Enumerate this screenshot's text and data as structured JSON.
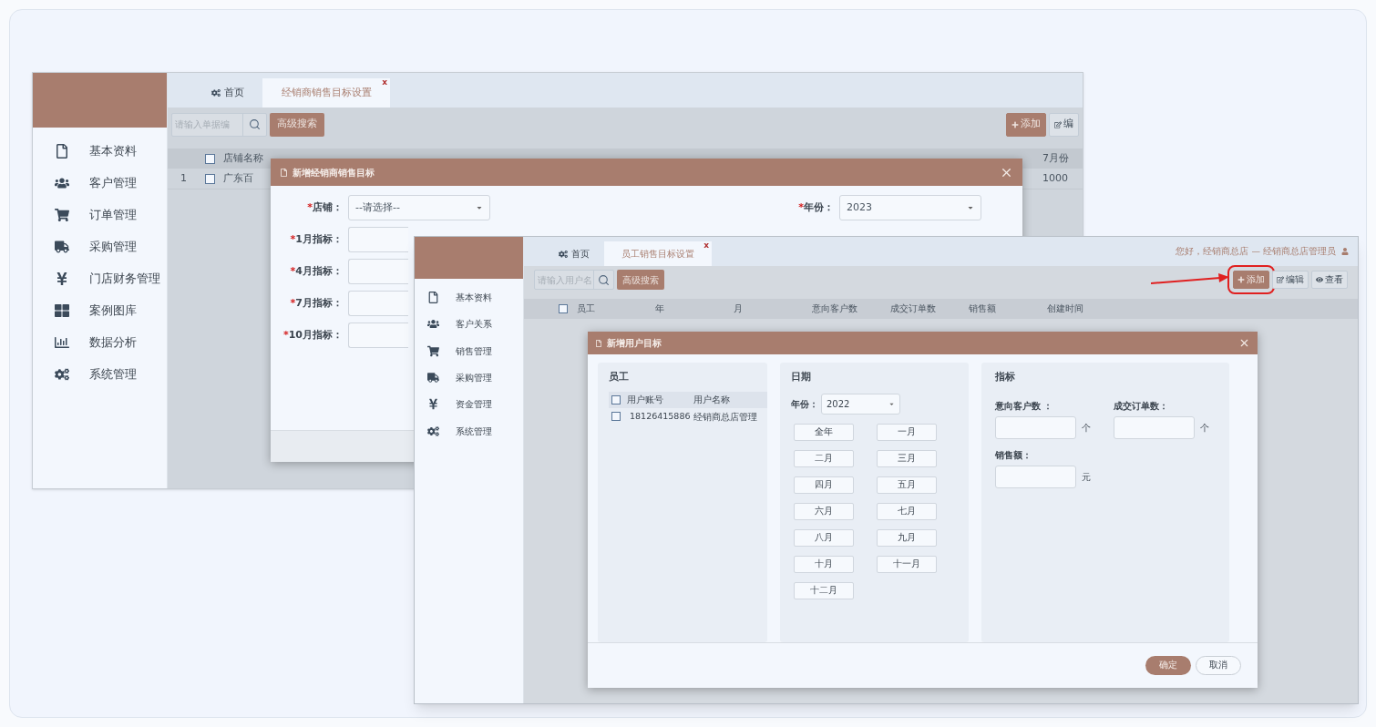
{
  "window_a": {
    "sidebar": [
      {
        "label": "基本资料"
      },
      {
        "label": "客户管理"
      },
      {
        "label": "订单管理"
      },
      {
        "label": "采购管理"
      },
      {
        "label": "门店财务管理"
      },
      {
        "label": "案例图库"
      },
      {
        "label": "数据分析"
      },
      {
        "label": "系统管理"
      }
    ],
    "tabs": [
      {
        "label": "首页",
        "selected": false
      },
      {
        "label": "经销商销售目标设置",
        "selected": true,
        "close": "x"
      }
    ],
    "search": {
      "placeholder": "请输入单据编"
    },
    "buttons": [
      {
        "label": "高级搜索"
      }
    ],
    "actions": [
      {
        "kind": "add",
        "label": "添加",
        "highlighted": false
      },
      {
        "kind": "edit",
        "label": "编",
        "highlighted": false
      }
    ],
    "table": {
      "header_checked": false,
      "columns": [
        "店铺名称",
        "7月份"
      ],
      "rows": [
        {
          "index": "1",
          "checked": false,
          "cells": [
            "广东百",
            "1000"
          ]
        }
      ]
    },
    "dialog": {
      "title": "新增经销商销售目标",
      "rows": [
        [
          {
            "marker": "*",
            "label": "店铺：",
            "kind": "select",
            "value": "--请选择--"
          },
          {
            "marker": "*",
            "label": "年份：",
            "kind": "select",
            "value": "2023"
          }
        ],
        [
          {
            "marker": "*",
            "label": "1月指标：",
            "kind": "input"
          }
        ],
        [
          {
            "marker": "*",
            "label": "4月指标：",
            "kind": "input"
          }
        ],
        [
          {
            "marker": "*",
            "label": "7月指标：",
            "kind": "input"
          }
        ],
        [
          {
            "marker": "*",
            "label": "10月指标：",
            "kind": "input"
          }
        ]
      ]
    }
  },
  "window_b": {
    "sidebar": [
      {
        "label": "基本资料"
      },
      {
        "label": "客户关系"
      },
      {
        "label": "销售管理"
      },
      {
        "label": "采购管理"
      },
      {
        "label": "资金管理"
      },
      {
        "label": "系统管理"
      }
    ],
    "tabs": [
      {
        "label": "首页",
        "selected": false
      },
      {
        "label": "员工销售目标设置",
        "selected": true,
        "close": "x"
      }
    ],
    "greeting": "您好，经销商总店 — 经销商总店管理员",
    "search": {
      "placeholder": "请输入用户名"
    },
    "buttons": [
      {
        "label": "高级搜索"
      }
    ],
    "actions": [
      {
        "kind": "add",
        "label": "添加",
        "highlighted": true
      },
      {
        "kind": "edit",
        "label": "编辑",
        "highlighted": false
      },
      {
        "kind": "view",
        "label": "查看",
        "highlighted": false
      }
    ],
    "table": {
      "header_checked": false,
      "columns": [
        "员工",
        "年",
        "月",
        "意向客户数",
        "成交订单数",
        "销售额",
        "创建时间"
      ]
    },
    "dialog": {
      "title": "新增用户目标",
      "employee": {
        "title": "员工",
        "header_checked": false,
        "columns": [
          "用户账号",
          "用户名称"
        ],
        "rows": [
          {
            "checked": false,
            "cells": [
              "18126415886",
              "经销商总店管理"
            ]
          }
        ]
      },
      "date": {
        "title": "日期",
        "year_label": "年份：",
        "year": "2022",
        "months": [
          "全年",
          "一月",
          "二月",
          "三月",
          "四月",
          "五月",
          "六月",
          "七月",
          "八月",
          "九月",
          "十月",
          "十一月",
          "十二月"
        ]
      },
      "metrics": {
        "title": "指标",
        "fields": [
          {
            "label": "意向客户数 ：",
            "unit": "个"
          },
          {
            "label": "成交订单数：",
            "unit": "个"
          },
          {
            "label": "销售额：",
            "unit": "元"
          }
        ]
      },
      "footer": [
        {
          "kind": "primary",
          "label": "确定"
        },
        {
          "kind": "secondary",
          "label": "取消"
        }
      ]
    }
  }
}
